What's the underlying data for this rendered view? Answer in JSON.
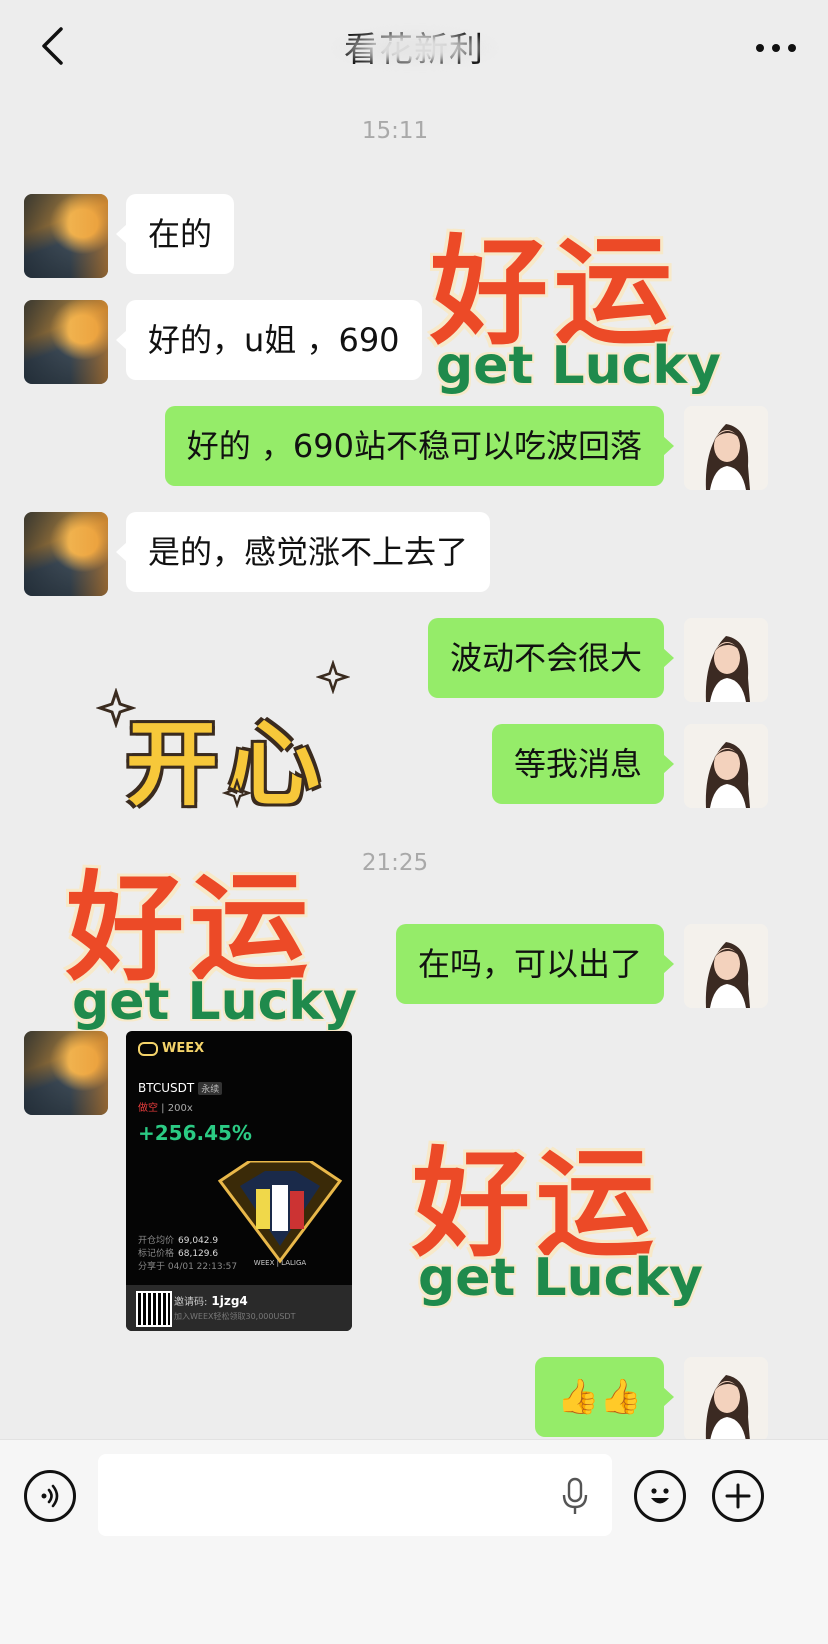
{
  "header": {
    "title": "看花新利",
    "back_icon": "chevron-left-icon",
    "more_icon": "more-dots-icon"
  },
  "timestamps": [
    "15:11",
    "21:25"
  ],
  "messages": [
    {
      "from": "other",
      "text": "在的"
    },
    {
      "from": "other",
      "text": "好的，u姐 ，690"
    },
    {
      "from": "self",
      "text": "好的 ，690站不稳可以吃波回落"
    },
    {
      "from": "other",
      "text": "是的，感觉涨不上去了"
    },
    {
      "from": "self",
      "text": "波动不会很大"
    },
    {
      "from": "self",
      "text": "等我消息"
    },
    {
      "from": "self",
      "text": "在吗，可以出了"
    },
    {
      "from": "self",
      "text": "👍👍"
    }
  ],
  "stickers": {
    "lucky": {
      "cn": "好运",
      "en": "get Lucky"
    },
    "happy": {
      "cn": "开心"
    }
  },
  "weex_card": {
    "brand": "WEEX",
    "pair": "BTCUSDT",
    "type": "永续",
    "side": "做空",
    "leverage": "200x",
    "pnl": "+256.45%",
    "entry_label": "开仓均价",
    "entry_value": "69,042.9",
    "mark_label": "标记价格",
    "mark_value": "68,129.6",
    "share_time": "分享于 04/01 22:13:57",
    "partner_text": "WEEX | LALIGA",
    "invite_label": "邀请码:",
    "invite_code": "1jzg4",
    "join_text": "加入WEEX轻松领取30,000USDT"
  },
  "input_bar": {
    "voice_icon": "voice-icon",
    "mic_icon": "mic-icon",
    "emoji_icon": "emoji-icon",
    "plus_icon": "plus-icon"
  },
  "colors": {
    "background": "#ededed",
    "bubble_self": "#95ec69",
    "bubble_other": "#ffffff",
    "lucky_red": "#ec4a27",
    "lucky_green": "#1f8a4c",
    "pnl_green": "#2bcb84"
  }
}
